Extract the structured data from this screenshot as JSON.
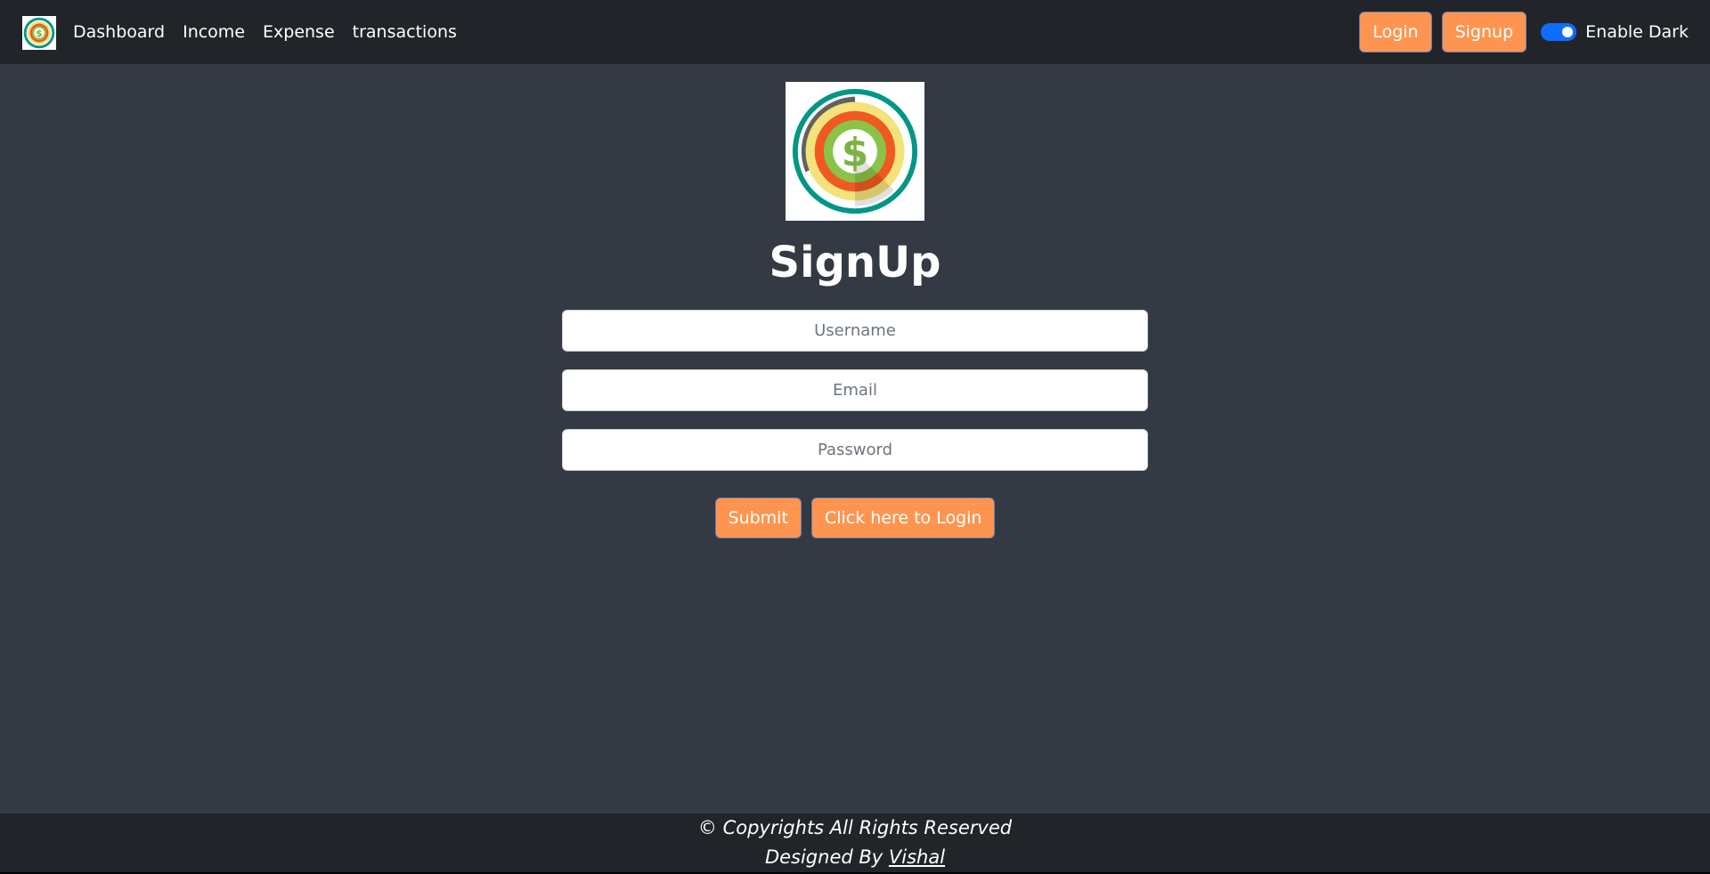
{
  "navbar": {
    "logo_icon": "dollar-target-logo-icon",
    "links": [
      "Dashboard",
      "Income",
      "Expense",
      "transactions"
    ],
    "login_label": "Login",
    "signup_label": "Signup",
    "dark_toggle_label": "Enable Dark",
    "dark_toggle_on": true
  },
  "main": {
    "logo_icon": "dollar-target-logo-icon",
    "title": "SignUp",
    "username_placeholder": "Username",
    "email_placeholder": "Email",
    "password_placeholder": "Password",
    "submit_label": "Submit",
    "login_link_label": "Click here to Login"
  },
  "footer": {
    "copyright": "© Copyrights All Rights Reserved",
    "designed_by_prefix": "Designed By",
    "designer_name": "Vishal"
  },
  "colors": {
    "navbar_bg": "#212429",
    "page_bg": "#343a44",
    "button_orange": "#fd9550",
    "toggle_blue": "#0d6efd"
  }
}
